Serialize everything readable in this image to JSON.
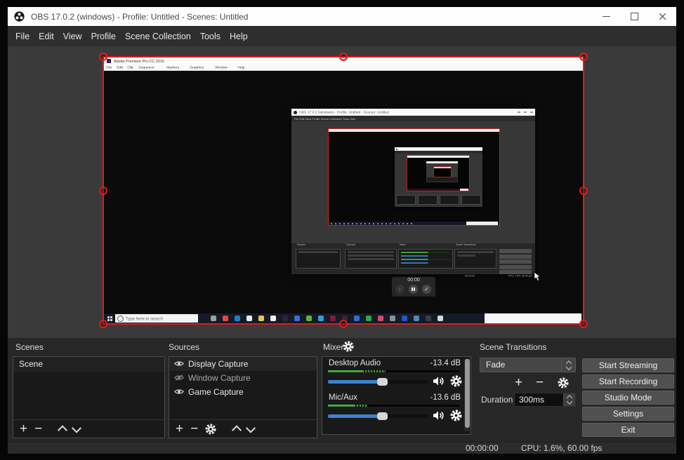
{
  "window": {
    "title": "OBS 17.0.2 (windows) - Profile: Untitled - Scenes: Untitled"
  },
  "menu_items": [
    "File",
    "Edit",
    "View",
    "Profile",
    "Scene Collection",
    "Tools",
    "Help"
  ],
  "preview": {
    "captured_app": {
      "title": "Adobe Premiere Pro CC 2015",
      "menu_items": [
        "File",
        "Edit",
        "Clip",
        "Sequence",
        "Markers",
        "Graphics",
        "Window",
        "Help"
      ]
    },
    "inner_obs": {
      "title": "OBS 17.0.2 (windows) - Profile: Untitled - Scenes: Untitled",
      "menu_text": "File    Edit    View    Profile    Scene Collection    Tools    Help"
    },
    "taskbar": {
      "search_placeholder": "Type here to search",
      "icon_colors": [
        "#9aa0a6",
        "#e8453c",
        "#1e7fd0",
        "#ececec",
        "#e8c35a",
        "#f0f0f0",
        "#33203a",
        "#3a6fd8",
        "#5cb832",
        "#2e9fe0",
        "#7a1f3a",
        "#402428",
        "#2e6fd0",
        "#2ea84a",
        "#d84a6a",
        "#8a8f98",
        "#2255cc",
        "#5588aa",
        "#3a3f46",
        "#d8d8d8"
      ]
    },
    "recorder_overlay": {
      "time": "00:00"
    }
  },
  "docks": {
    "scenes": {
      "header": "Scenes",
      "items": [
        "Scene"
      ]
    },
    "sources": {
      "header": "Sources",
      "items": [
        {
          "label": "Display Capture",
          "visible": true
        },
        {
          "label": "Window Capture",
          "visible": false
        },
        {
          "label": "Game Capture",
          "visible": true
        }
      ]
    },
    "mixer": {
      "header": "Mixer",
      "channels": [
        {
          "name": "Desktop Audio",
          "db": "-13.4 dB",
          "meter_solid_pct": 26,
          "meter_stripe_pct": 18,
          "volume_pct": 55
        },
        {
          "name": "Mic/Aux",
          "db": "-13.6 dB",
          "meter_solid_pct": 20,
          "meter_stripe_pct": 10,
          "volume_pct": 55
        }
      ]
    },
    "transitions": {
      "header": "Scene Transitions",
      "selected": "Fade",
      "duration_label": "Duration",
      "duration_value": "300ms"
    }
  },
  "control_buttons": [
    "Start Streaming",
    "Start Recording",
    "Studio Mode",
    "Settings",
    "Exit"
  ],
  "status_bar": {
    "time": "00:00:00",
    "stats": "CPU: 1.6%, 60.00 fps"
  }
}
